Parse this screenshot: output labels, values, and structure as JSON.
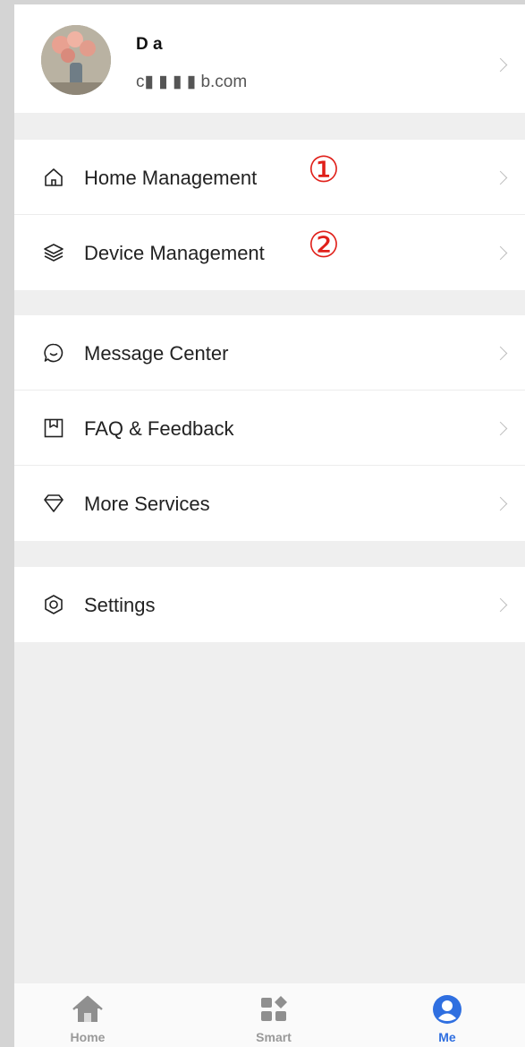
{
  "profile": {
    "name": "D  a",
    "email": "c▮ ▮ ▮ ▮ b.com"
  },
  "menu": {
    "group1": [
      {
        "label": "Home Management",
        "icon": "home-icon",
        "badge": "①"
      },
      {
        "label": "Device Management",
        "icon": "layers-icon",
        "badge": "②"
      }
    ],
    "group2": [
      {
        "label": "Message Center",
        "icon": "chat-bubble-icon"
      },
      {
        "label": "FAQ & Feedback",
        "icon": "bookmark-book-icon"
      },
      {
        "label": "More Services",
        "icon": "diamond-icon"
      }
    ],
    "group3": [
      {
        "label": "Settings",
        "icon": "settings-hexagon-icon"
      }
    ]
  },
  "tabbar": {
    "tabs": [
      {
        "label": "Home",
        "icon": "house-icon"
      },
      {
        "label": "Smart",
        "icon": "smart-grid-icon"
      },
      {
        "label": "Me",
        "icon": "person-icon"
      }
    ],
    "active": "Me",
    "active_color": "#2f6fe0"
  },
  "colors": {
    "badge": "#e0201a",
    "background": "#efefef"
  }
}
